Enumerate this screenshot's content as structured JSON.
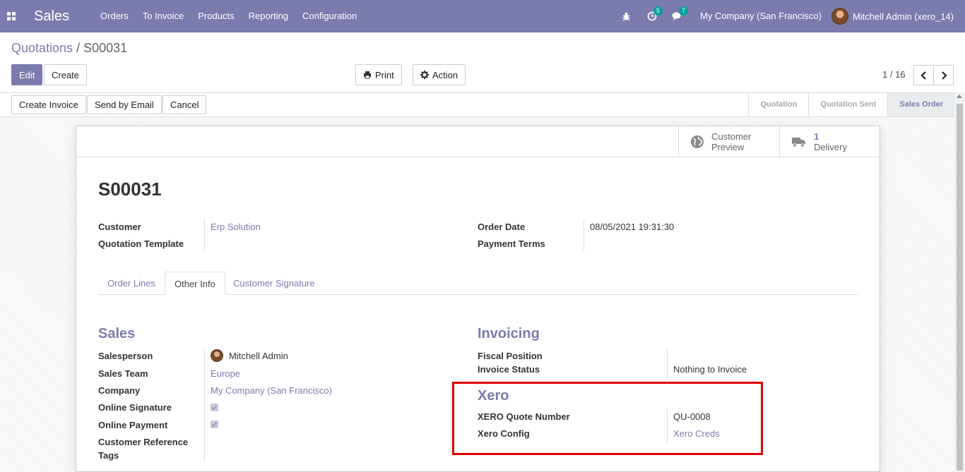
{
  "navbar": {
    "brand": "Sales",
    "menu": [
      "Orders",
      "To Invoice",
      "Products",
      "Reporting",
      "Configuration"
    ],
    "activity_count": "5",
    "message_count": "7",
    "company": "My Company (San Francisco)",
    "user": "Mitchell Admin (xero_14)"
  },
  "breadcrumb": {
    "parent": "Quotations",
    "separator": "/",
    "current": "S00031"
  },
  "buttons": {
    "edit": "Edit",
    "create": "Create",
    "print": "Print",
    "action": "Action"
  },
  "pager": {
    "value": "1 / 16"
  },
  "statusbar": {
    "buttons": [
      "Create Invoice",
      "Send by Email",
      "Cancel"
    ],
    "stages": [
      "Quotation",
      "Quotation Sent",
      "Sales Order"
    ],
    "active_stage": "Sales Order"
  },
  "smart_buttons": {
    "preview_line1": "Customer",
    "preview_line2": "Preview",
    "delivery_count": "1",
    "delivery_label": "Delivery"
  },
  "record": {
    "name": "S00031",
    "customer_label": "Customer",
    "customer_value": "Erp Solution",
    "template_label": "Quotation Template",
    "order_date_label": "Order Date",
    "order_date_value": "08/05/2021 19:31:30",
    "payment_terms_label": "Payment Terms"
  },
  "tabs": [
    "Order Lines",
    "Other Info",
    "Customer Signature"
  ],
  "sales_section": {
    "title": "Sales",
    "salesperson_label": "Salesperson",
    "salesperson_value": "Mitchell Admin",
    "team_label": "Sales Team",
    "team_value": "Europe",
    "company_label": "Company",
    "company_value": "My Company (San Francisco)",
    "signature_label": "Online Signature",
    "payment_label": "Online Payment",
    "customer_ref_label_1": "Customer Reference",
    "customer_ref_label_2": "Tags"
  },
  "invoicing_section": {
    "title": "Invoicing",
    "fiscal_label": "Fiscal Position",
    "status_label": "Invoice Status",
    "status_value": "Nothing to Invoice"
  },
  "xero_section": {
    "title": "Xero",
    "quote_label": "XERO Quote Number",
    "quote_value": "QU-0008",
    "config_label": "Xero Config",
    "config_value": "Xero Creds"
  }
}
